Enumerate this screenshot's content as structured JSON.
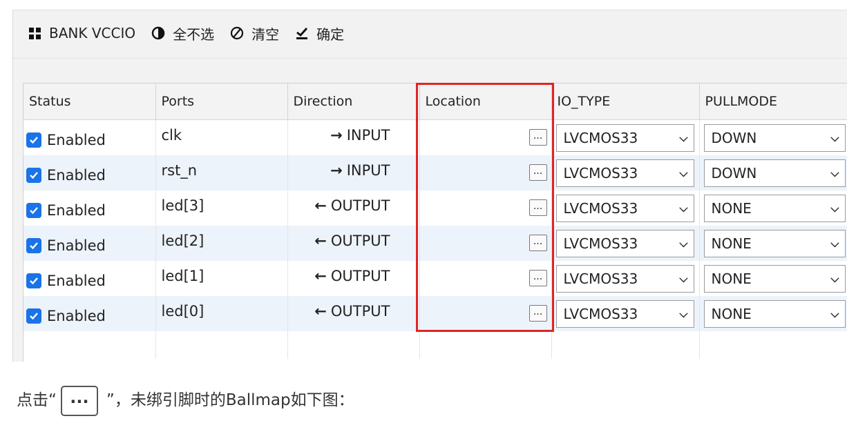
{
  "toolbar": {
    "bank_vccio": {
      "label": "BANK VCCIO",
      "icon": "grid-icon"
    },
    "deselect_all": {
      "label": "全不选",
      "icon": "half-circle-icon"
    },
    "clear": {
      "label": "清空",
      "icon": "prohibit-icon"
    },
    "confirm": {
      "label": "确定",
      "icon": "check-underline-icon"
    }
  },
  "table": {
    "headers": [
      "Status",
      "Ports",
      "Direction",
      "Location",
      "IO_TYPE",
      "PULLMODE"
    ],
    "rows": [
      {
        "status": "Enabled",
        "checked": true,
        "port": "clk",
        "direction": "INPUT",
        "dir_arrow": "→",
        "location": "",
        "location_button": "...",
        "io_type": "LVCMOS33",
        "pullmode": "DOWN"
      },
      {
        "status": "Enabled",
        "checked": true,
        "port": "rst_n",
        "direction": "INPUT",
        "dir_arrow": "→",
        "location": "",
        "location_button": "...",
        "io_type": "LVCMOS33",
        "pullmode": "DOWN"
      },
      {
        "status": "Enabled",
        "checked": true,
        "port": "led[3]",
        "direction": "OUTPUT",
        "dir_arrow": "←",
        "location": "",
        "location_button": "...",
        "io_type": "LVCMOS33",
        "pullmode": "NONE"
      },
      {
        "status": "Enabled",
        "checked": true,
        "port": "led[2]",
        "direction": "OUTPUT",
        "dir_arrow": "←",
        "location": "",
        "location_button": "...",
        "io_type": "LVCMOS33",
        "pullmode": "NONE"
      },
      {
        "status": "Enabled",
        "checked": true,
        "port": "led[1]",
        "direction": "OUTPUT",
        "dir_arrow": "←",
        "location": "",
        "location_button": "...",
        "io_type": "LVCMOS33",
        "pullmode": "NONE"
      },
      {
        "status": "Enabled",
        "checked": true,
        "port": "led[0]",
        "direction": "OUTPUT",
        "dir_arrow": "←",
        "location": "",
        "location_button": "...",
        "io_type": "LVCMOS33",
        "pullmode": "NONE"
      }
    ]
  },
  "colors": {
    "checkbox": "#1a73e8",
    "highlight_box": "#e02424",
    "row_alt": "#edf3fb"
  },
  "caption": {
    "prefix": "点击“",
    "button_text": "...",
    "suffix": "”，未绑引脚时的Ballmap如下图："
  }
}
